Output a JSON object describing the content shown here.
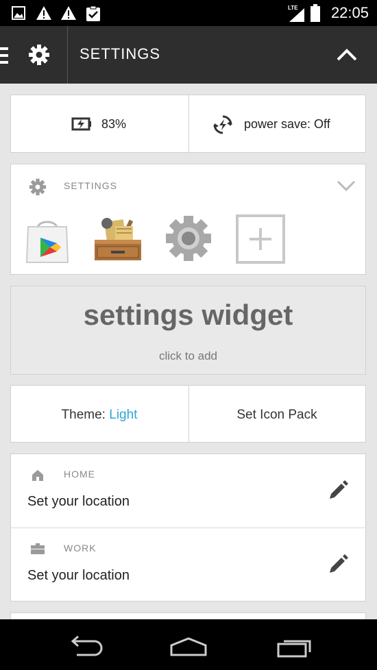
{
  "status_bar": {
    "time": "22:05",
    "network": "LTE",
    "icons": [
      "image-icon",
      "warning-icon",
      "warning-icon",
      "clipboard-check-icon",
      "signal-icon",
      "battery-icon"
    ]
  },
  "app_bar": {
    "title": "SETTINGS",
    "menu_icon": "menu-icon",
    "gear_icon": "gear-icon",
    "collapse_icon": "chevron-up-icon"
  },
  "toggles": {
    "battery_percent": "83%",
    "power_save": "power save: Off"
  },
  "shortcuts": {
    "label": "SETTINGS",
    "apps": [
      "play-store-icon",
      "toolbox-icon",
      "settings-gear-icon",
      "add-icon"
    ]
  },
  "widget": {
    "title": "settings widget",
    "subtitle": "click to add"
  },
  "theme": {
    "label": "Theme: ",
    "value": "Light",
    "icon_pack": "Set Icon Pack"
  },
  "locations": [
    {
      "label": "HOME",
      "value": "Set your location"
    },
    {
      "label": "WORK",
      "value": "Set your location"
    }
  ],
  "colors": {
    "accent": "#2ba6d6",
    "app_bar": "#2e2e2e",
    "background": "#e6e6e6"
  }
}
